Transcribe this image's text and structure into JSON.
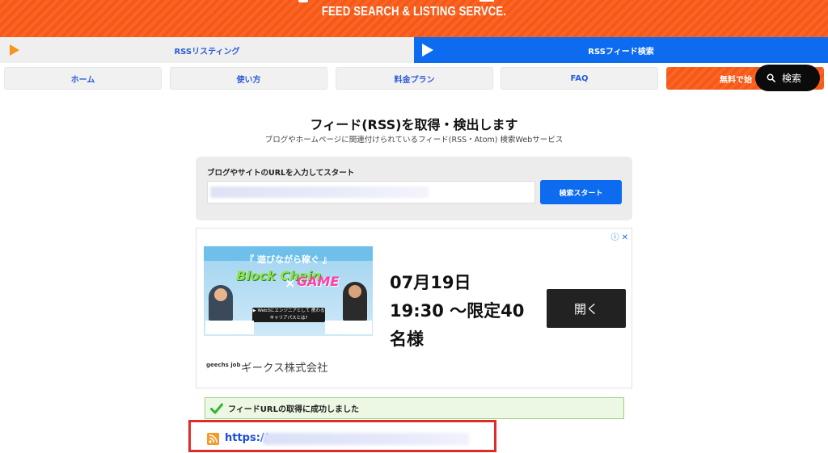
{
  "header": {
    "tagline": "FEED SEARCH & LISTING SERVCE.",
    "colors": {
      "brand_orange": "#f4581a",
      "accent_blue": "#0d6bf0"
    }
  },
  "tabs": [
    {
      "label": "RSSリスティング",
      "active": false
    },
    {
      "label": "RSSフィード検索",
      "active": true
    }
  ],
  "nav": [
    {
      "label": "ホーム"
    },
    {
      "label": "使い方"
    },
    {
      "label": "料金プラン"
    },
    {
      "label": "FAQ"
    },
    {
      "label": "無料で始"
    }
  ],
  "search_pill": {
    "label": "検索",
    "icon": "search-icon"
  },
  "main": {
    "title": "フィード(RSS)を取得・検出します",
    "subtitle": "ブログやホームページに関連付けられているフィード(RSS・Atom) 検索Webサービス"
  },
  "form": {
    "label": "ブログやサイトのURLを入力してスタート",
    "input_value": "",
    "button_label": "検索スタート"
  },
  "ad": {
    "choice_glyph": "ⓘ ✕",
    "banner_heading": "『 遊びながら稼ぐ 』",
    "banner_word1": "Block Chain",
    "banner_x": "×",
    "banner_word2": "GAME",
    "banner_pill": "▶ Web3にエンジニアとして 携わるキャリアパスとは?",
    "headline_line1": "07月19日",
    "headline_line2": "19:30 〜限定40",
    "headline_line3": "名様",
    "open_label": "開く",
    "brand_logo": "geechs job",
    "advertiser": "ギークス株式会社"
  },
  "result": {
    "success_text": "フィードURLの取得に成功しました",
    "link_prefix": "https://",
    "icon": "rss-icon"
  }
}
